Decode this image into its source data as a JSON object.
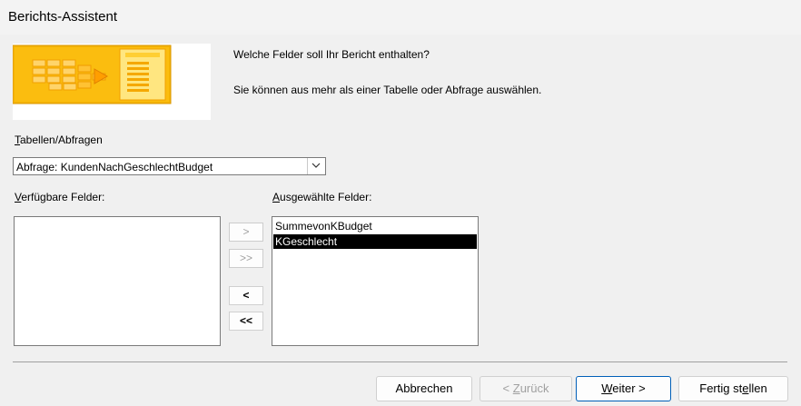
{
  "window": {
    "title": "Berichts-Assistent"
  },
  "intro": {
    "question": "Welche Felder soll Ihr Bericht enthalten?",
    "hint": "Sie können aus mehr als einer Tabelle oder Abfrage auswählen."
  },
  "source": {
    "label_prefix": "",
    "label_key": "T",
    "label_rest": "abellen/Abfragen",
    "selected": "Abfrage: KundenNachGeschlechtBudget"
  },
  "available": {
    "label_key": "V",
    "label_rest": "erfügbare Felder:",
    "items": []
  },
  "selected_fields": {
    "label_key": "A",
    "label_rest": "usgewählte Felder:",
    "items": [
      "SummevonKBudget",
      "KGeschlecht"
    ],
    "selected_index": 1
  },
  "move_buttons": {
    "add": ">",
    "add_all": ">>",
    "remove": "<",
    "remove_all": "<<"
  },
  "footer": {
    "cancel": "Abbrechen",
    "back_prefix": "< ",
    "back_key": "Z",
    "back_rest": "urück",
    "next_key": "W",
    "next_rest": "eiter >",
    "finish_pre": "Fertig st",
    "finish_key": "e",
    "finish_rest": "llen"
  },
  "colors": {
    "banner_orange": "#f5b400",
    "banner_yellow": "#ffd84d",
    "selection": "#000000",
    "default_button_border": "#005fb8"
  }
}
